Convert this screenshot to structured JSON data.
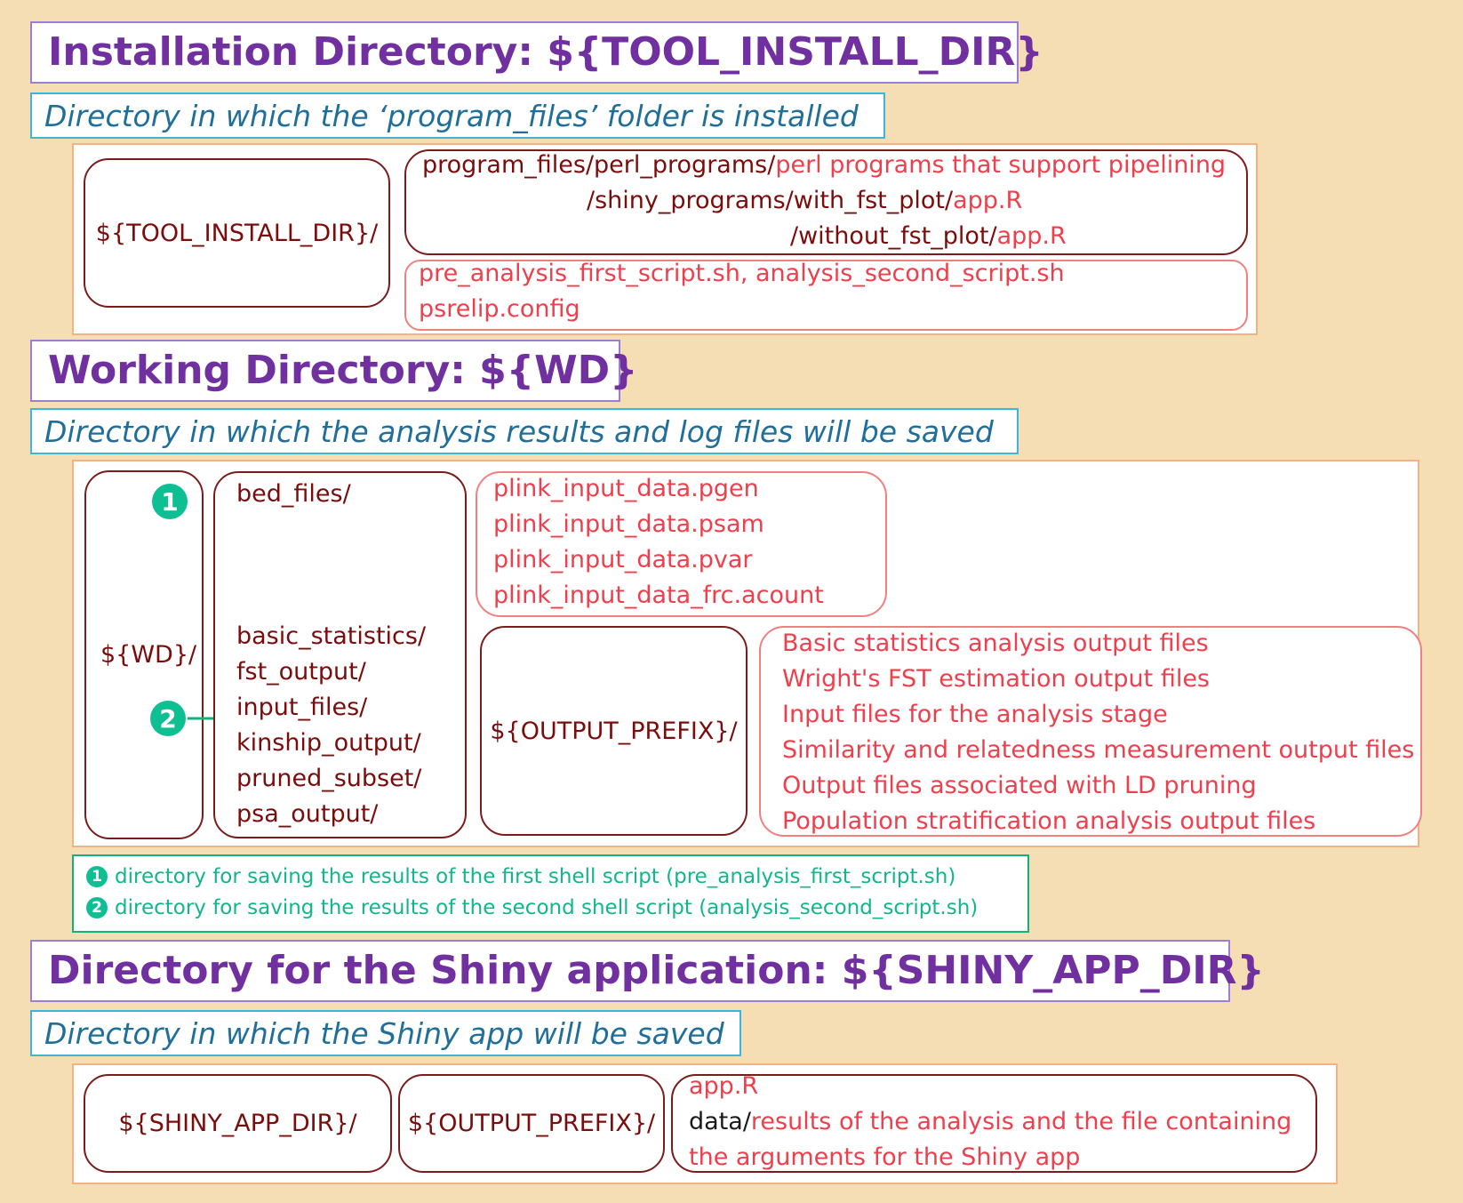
{
  "sections": {
    "install": {
      "title": "Installation Directory: ${TOOL_INSTALL_DIR}",
      "subtitle": "Directory in which the ‘program_files’ folder is installed",
      "root_label": "${TOOL_INSTALL_DIR}/",
      "prog_line1_path": "program_files/perl_programs/",
      "prog_line1_desc": "perl programs that support pipelining",
      "prog_line2_path": "/shiny_programs/with_fst_plot/",
      "prog_line2_file": "app.R",
      "prog_line3_path": "/without_fst_plot/",
      "prog_line3_file": "app.R",
      "scripts_line1": "pre_analysis_first_script.sh, analysis_second_script.sh",
      "scripts_line2": "psrelip.config"
    },
    "working": {
      "title": "Working Directory: ${WD}",
      "subtitle": "Directory in which the analysis results and log files will be saved",
      "root_label": "${WD}/",
      "marker1": "1",
      "marker2": "2",
      "bed_dir": "bed_files/",
      "subdirs": [
        "basic_statistics/",
        "fst_output/",
        "input_files/",
        "kinship_output/",
        "pruned_subset/",
        "psa_output/"
      ],
      "bed_files": [
        "plink_input_data.pgen",
        "plink_input_data.psam",
        "plink_input_data.pvar",
        "plink_input_data_frc.acount"
      ],
      "output_prefix": "${OUTPUT_PREFIX}/",
      "output_descriptions": [
        "Basic statistics analysis output files",
        "Wright's FST estimation output files",
        "Input files for the analysis stage",
        "Similarity and relatedness measurement output files",
        "Output files associated with LD pruning",
        "Population stratification analysis output files"
      ]
    },
    "legend": {
      "line1_marker": "1",
      "line1": "directory for saving the results of the first shell script (pre_analysis_first_script.sh)",
      "line2_marker": "2",
      "line2": "directory for saving the results of the second shell script (analysis_second_script.sh)"
    },
    "shiny": {
      "title": "Directory for the Shiny application: ${SHINY_APP_DIR}",
      "subtitle": "Directory in which the Shiny app will be saved",
      "root_label": "${SHINY_APP_DIR}/",
      "prefix_label": "${OUTPUT_PREFIX}/",
      "file_app": "app.R",
      "data_dir": "data/",
      "data_desc_line1": "results of the analysis and the file containing",
      "data_desc_line2": "the arguments for the Shiny app"
    }
  },
  "colors": {
    "background": "#f5deb3",
    "title": "#7030a0",
    "subtitle": "#1f6f9a",
    "dir_text": "#7b0c0c",
    "file_text": "#ee3f4c",
    "marker": "#0fbf94"
  }
}
